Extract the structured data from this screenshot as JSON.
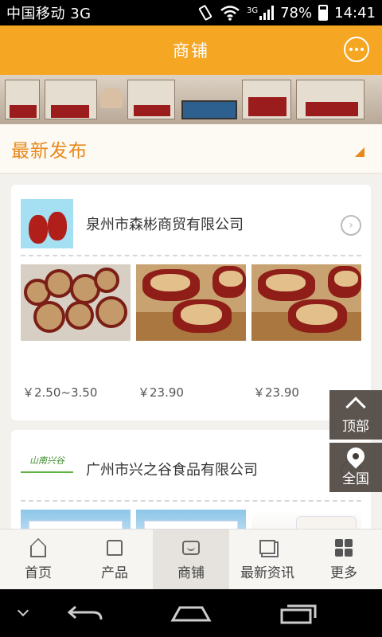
{
  "status_bar": {
    "carrier": "中国移动 3G",
    "network": "3G",
    "battery": "78%",
    "time": "14:41"
  },
  "header": {
    "title": "商铺",
    "chat_icon": "chat-bubble-icon"
  },
  "section": {
    "title": "最新发布"
  },
  "shops": [
    {
      "name": "泉州市森彬商贸有限公司",
      "products": [
        {
          "price": "￥2.50~3.50"
        },
        {
          "price": "￥23.90"
        },
        {
          "price": "￥23.90"
        }
      ]
    },
    {
      "name": "广州市兴之谷食品有限公司",
      "logo_text": "山南兴谷"
    }
  ],
  "side_buttons": {
    "top": "顶部",
    "map": "全国"
  },
  "bottom_nav": [
    {
      "label": "首页",
      "icon": "home-icon"
    },
    {
      "label": "产品",
      "icon": "shirt-icon"
    },
    {
      "label": "商铺",
      "icon": "shop-icon",
      "active": true
    },
    {
      "label": "最新资讯",
      "icon": "news-icon"
    },
    {
      "label": "更多",
      "icon": "grid-icon"
    }
  ]
}
